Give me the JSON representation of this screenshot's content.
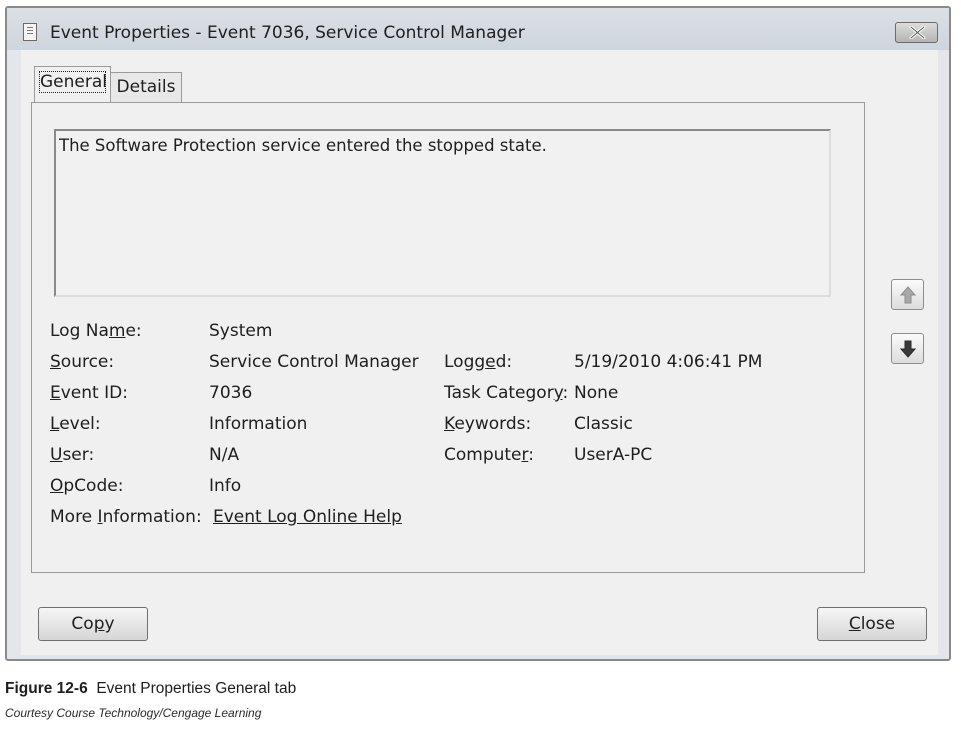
{
  "window": {
    "title": "Event Properties - Event 7036, Service Control Manager",
    "icons": {
      "app": "event-log-icon",
      "close": "close-icon"
    }
  },
  "tabs": [
    {
      "label": "General",
      "selected": true
    },
    {
      "label": "Details",
      "selected": false
    }
  ],
  "general": {
    "description": "The Software Protection service entered the stopped state.",
    "fields": {
      "log_name": {
        "label_before": "Log Na",
        "label_access": "m",
        "label_after": "e:",
        "value": "System"
      },
      "source": {
        "label_before": "",
        "label_access": "S",
        "label_after": "ource:",
        "value": "Service Control Manager"
      },
      "event_id": {
        "label_before": "",
        "label_access": "E",
        "label_after": "vent ID:",
        "value": "7036"
      },
      "level": {
        "label_before": "",
        "label_access": "L",
        "label_after": "evel:",
        "value": "Information"
      },
      "user": {
        "label_before": "",
        "label_access": "U",
        "label_after": "ser:",
        "value": "N/A"
      },
      "opcode": {
        "label_before": "",
        "label_access": "O",
        "label_after": "pCode:",
        "value": "Info"
      },
      "more_info": {
        "label_before": "More ",
        "label_access": "I",
        "label_after": "nformation:",
        "link": "Event Log Online Help"
      },
      "logged": {
        "label_before": "Logg",
        "label_access": "e",
        "label_after": "d:",
        "value": "5/19/2010 4:06:41 PM"
      },
      "task_category": {
        "label_before": "Task Categor",
        "label_access": "y",
        "label_after": ":",
        "value": "None"
      },
      "keywords": {
        "label_before": "",
        "label_access": "K",
        "label_after": "eywords:",
        "value": "Classic"
      },
      "computer": {
        "label_before": "Compute",
        "label_access": "r",
        "label_after": ":",
        "value": "UserA-PC"
      }
    }
  },
  "nav": {
    "up_icon": "arrow-up-icon",
    "down_icon": "arrow-down-icon"
  },
  "buttons": {
    "copy": {
      "before": "Co",
      "access": "p",
      "after": "y"
    },
    "close": {
      "before": "",
      "access": "C",
      "after": "lose"
    }
  },
  "figure": {
    "number": "Figure 12-6",
    "caption": "Event Properties General tab",
    "credit": "Courtesy Course Technology/Cengage Learning"
  }
}
